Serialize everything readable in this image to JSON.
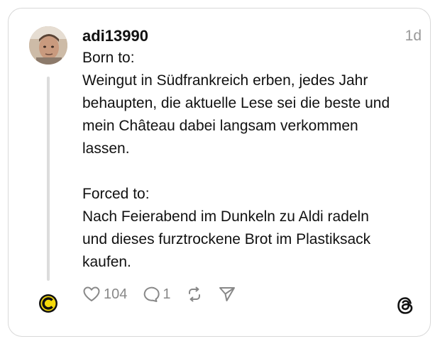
{
  "post": {
    "username": "adi13990",
    "time": "1d",
    "lines": [
      "Born to:",
      "Weingut in Südfrankreich erben, jedes Jahr",
      "behaupten, die aktuelle Lese sei die beste und",
      "mein Château dabei langsam verkommen",
      "lassen.",
      "",
      "Forced to:",
      "Nach Feierabend im Dunkeln zu Aldi radeln",
      "und dieses furztrockene Brot im Plastiksack",
      "kaufen."
    ],
    "likes": "104",
    "replies": "1"
  },
  "icons": {
    "like": "heart-icon",
    "reply": "comment-icon",
    "repost": "repost-icon",
    "share": "send-icon",
    "brand": "threads-logo-icon"
  },
  "colors": {
    "text": "#111111",
    "muted": "#999999",
    "border": "#d8d8d8",
    "small_avatar_bg": "#f5d90a"
  }
}
